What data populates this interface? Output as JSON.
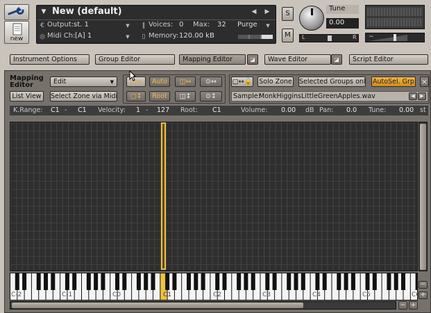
{
  "instrument": {
    "name": "New (default)",
    "output_label": "Output:",
    "output_value": "st. 1",
    "voices_label": "Voices:",
    "voices_value": "0",
    "max_label": "Max:",
    "max_value": "32",
    "purge_label": "Purge",
    "midi_label": "Midi Ch:",
    "midi_value": "[A]  1",
    "memory_label": "Memory:",
    "memory_value": "120.00 kB",
    "solo_label": "S",
    "mute_label": "M",
    "tune_label": "Tune",
    "tune_value": "0.00",
    "pan_left": "L",
    "pan_right": "R",
    "new_label": "new"
  },
  "tabs": [
    {
      "label": "Instrument Options"
    },
    {
      "label": "Group Editor"
    },
    {
      "label": "Mapping Editor"
    },
    {
      "label": "Wave Editor"
    },
    {
      "label": "Script Editor"
    }
  ],
  "mapping": {
    "title_line1": "Mapping",
    "title_line2": "Editor",
    "edit_label": "Edit",
    "list_view": "List View",
    "select_zone_midi": "Select Zone via Midi",
    "auto_label": "Auto",
    "root_label": "Root",
    "solo_zone": "Solo Zone",
    "selected_groups_only": "Selected Groups only",
    "autosel_grp": "AutoSel. Grp",
    "close_label": "×",
    "sample_label": "Sample:",
    "sample_value": "MonkHigginsLittleGreenApples.wav"
  },
  "zone_info": {
    "krange_label": "K.Range:",
    "krange_low": "C1",
    "krange_dash": "-",
    "krange_high": "C1",
    "velocity_label": "Velocity:",
    "vel_low": "1",
    "vel_dash": "-",
    "vel_high": "127",
    "root_label": "Root:",
    "root_value": "C1",
    "volume_label": "Volume:",
    "volume_value": "0.00",
    "volume_unit": "dB",
    "pan_label": "Pan:",
    "pan_value": "0.0",
    "tune_label": "Tune:",
    "tune_value": "0.00",
    "tune_unit": "st"
  },
  "keyboard": {
    "octave_labels": [
      "C-2",
      "C-1",
      "C0",
      "C1",
      "C2",
      "C3",
      "C4",
      "C5",
      "C6"
    ],
    "minus_label": "−",
    "plus_label": "+"
  },
  "colors": {
    "accent_orange": "#e8a21a",
    "zone_highlight": "#f0c040",
    "grid_bg": "#2e2e2e",
    "panel_bg": "#c9c3bb"
  }
}
